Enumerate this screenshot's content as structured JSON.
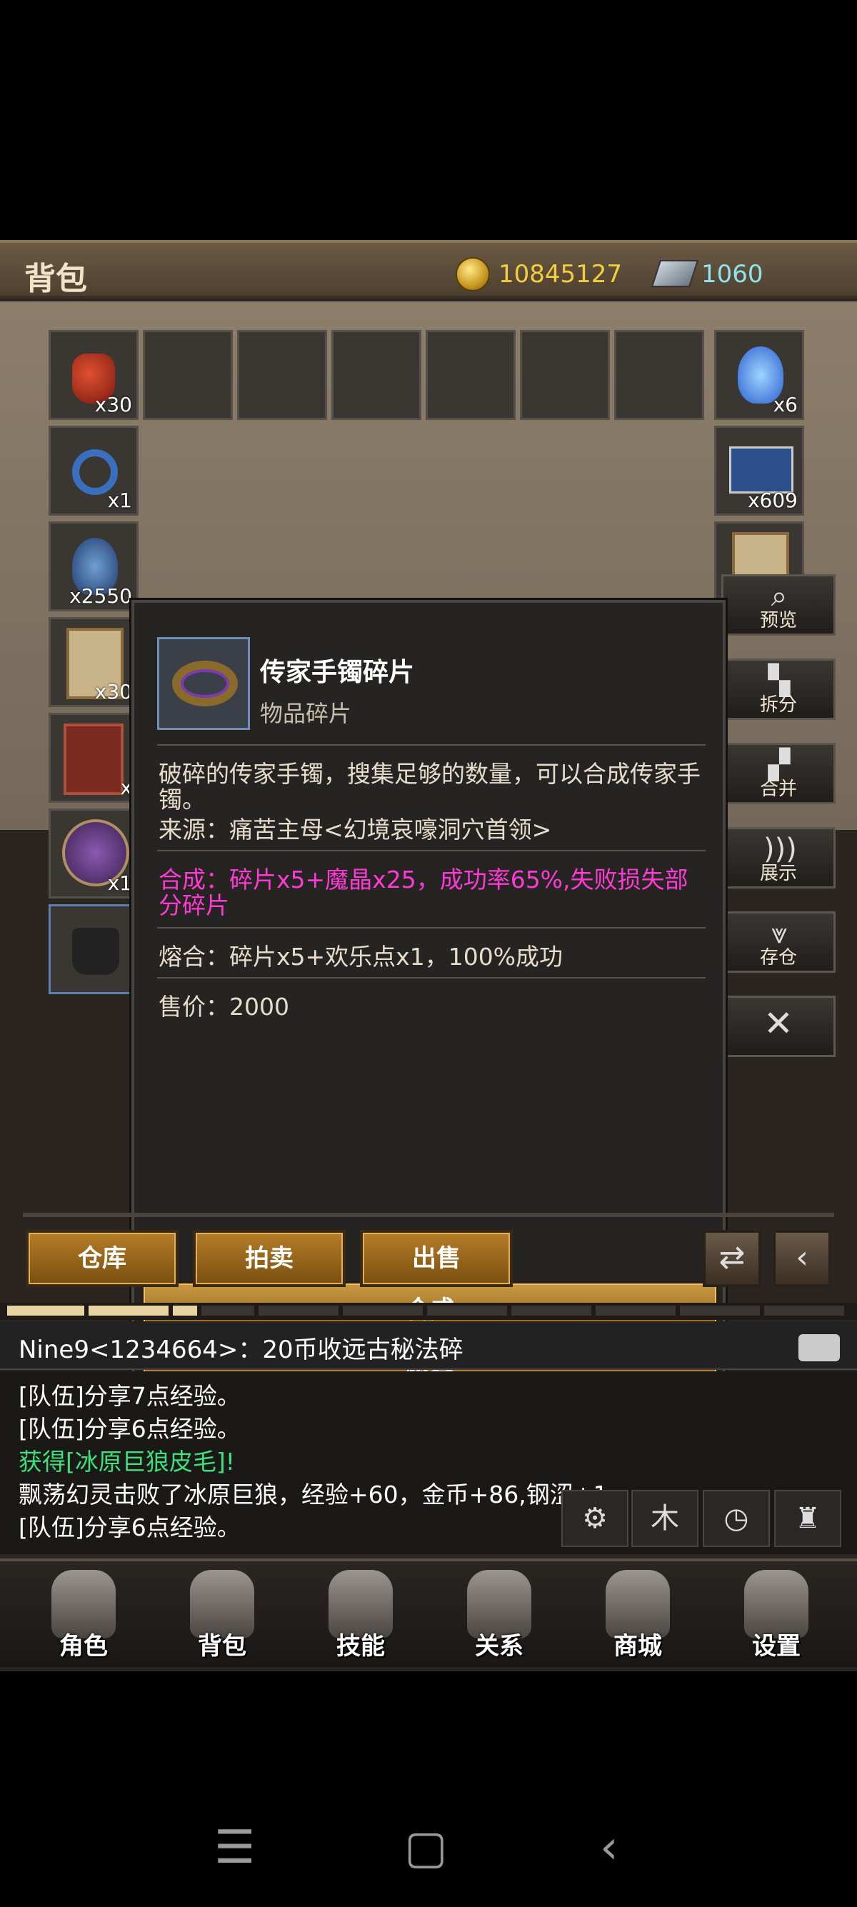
{
  "header": {
    "title": "背包",
    "gold": "10845127",
    "gems": "1060"
  },
  "slots": [
    {
      "count": "x30"
    },
    {
      "count": "x6"
    },
    {
      "count": "x1"
    },
    {
      "count": "x609"
    },
    {
      "count": "x2550"
    },
    {
      "count": "x30"
    },
    {
      "count": "x"
    },
    {
      "count": "x1"
    }
  ],
  "side_buttons": {
    "preview": "预览",
    "split": "拆分",
    "merge": "合并",
    "show": "展示",
    "store": "存仓"
  },
  "popup": {
    "name": "传家手镯碎片",
    "type": "物品碎片",
    "desc": "破碎的传家手镯，搜集足够的数量，可以合成传家手镯。",
    "source": "来源：痛苦主母<幻境哀嚎洞穴首领>",
    "synth": "合成：碎片x5+魔晶x25，成功率65%,失败损失部分碎片",
    "fuse": "熔合：碎片x5+欢乐点x1，100%成功",
    "price": "售价：2000",
    "btn_synth": "合成",
    "btn_fuse": "熔合"
  },
  "actions": {
    "warehouse": "仓库",
    "auction": "拍卖",
    "sell": "出售"
  },
  "chat": {
    "top": "Nine9<1234664>：20币收远古秘法碎",
    "lines": [
      "[队伍]分享7点经验。",
      "[队伍]分享6点经验。",
      "获得[冰原巨狼皮毛]!",
      "飘荡幻灵击败了冰原巨狼，经验+60，金币+86,钢涩+1",
      "[队伍]分享6点经验。"
    ]
  },
  "nav": [
    "角色",
    "背包",
    "技能",
    "关系",
    "商城",
    "设置"
  ]
}
